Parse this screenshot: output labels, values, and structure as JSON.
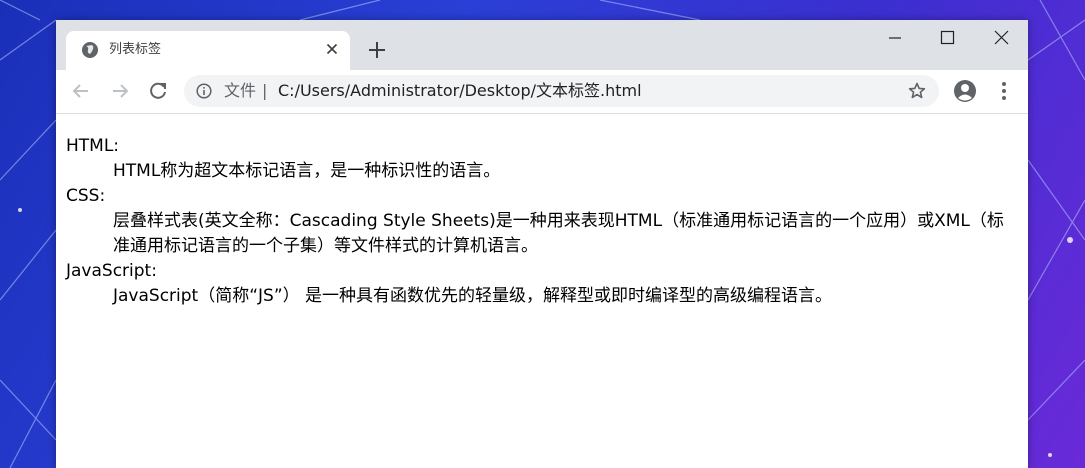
{
  "browser": {
    "tab": {
      "title": "列表标签",
      "favicon": "globe-icon",
      "close_icon": "close-icon"
    },
    "new_tab_icon": "plus-icon",
    "window_controls": [
      "minimize-icon",
      "maximize-icon",
      "close-icon"
    ],
    "toolbar": {
      "back_icon": "arrow-left-icon",
      "forward_icon": "arrow-right-icon",
      "reload_icon": "reload-icon",
      "info_icon": "info-icon",
      "scheme_label": "文件",
      "separator": "|",
      "url": "C:/Users/Administrator/Desktop/文本标签.html",
      "bookmark_icon": "star-icon",
      "profile_icon": "account-icon",
      "menu_icon": "more-vert-icon"
    }
  },
  "page": {
    "items": [
      {
        "term": "HTML:",
        "desc": "HTML称为超文本标记语言，是一种标识性的语言。"
      },
      {
        "term": "CSS:",
        "desc": "层叠样式表(英文全称：Cascading Style Sheets)是一种用来表现HTML（标准通用标记语言的一个应用）或XML（标准通用标记语言的一个子集）等文件样式的计算机语言。"
      },
      {
        "term": "JavaScript:",
        "desc": "JavaScript（简称“JS”） 是一种具有函数优先的轻量级，解释型或即时编译型的高级编程语言。"
      }
    ]
  },
  "colors": {
    "tabstrip": "#dee1e6",
    "omnibox": "#f1f3f4",
    "icon": "#5f6368",
    "desktop_start": "#1a2fb8",
    "desktop_end": "#6a2ad8"
  }
}
